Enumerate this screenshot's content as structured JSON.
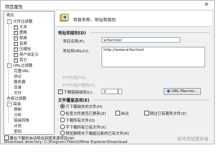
{
  "window": {
    "title": "项目属性",
    "close_glyph": "✕"
  },
  "tree": {
    "root_label": "项目",
    "items": [
      {
        "label": "文件过滤器",
        "toggle": "−",
        "level": 0
      },
      {
        "label": "文本",
        "checked": true,
        "level": 1
      },
      {
        "label": "图像",
        "checked": true,
        "level": 1
      },
      {
        "label": "视频",
        "checked": true,
        "level": 1
      },
      {
        "label": "音频",
        "checked": true,
        "level": 1
      },
      {
        "label": "压缩包",
        "checked": true,
        "level": 1
      },
      {
        "label": "用户自定义",
        "checked": true,
        "level": 1
      },
      {
        "label": "其它",
        "checked": true,
        "level": 1
      },
      {
        "label": "URL过滤器",
        "toggle": "−",
        "level": 0
      },
      {
        "label": "完整URL",
        "level": 1
      },
      {
        "label": "协议",
        "level": 1
      },
      {
        "label": "服务器",
        "level": 1
      },
      {
        "label": "目录",
        "level": 1
      },
      {
        "label": "文件",
        "level": 1
      },
      {
        "label": "内容过滤器",
        "level": 0
      },
      {
        "label": "高级",
        "toggle": "−",
        "level": 0
      },
      {
        "label": "限制",
        "level": 1
      },
      {
        "label": "分析",
        "level": 1
      },
      {
        "label": "链接转换",
        "level": 1
      },
      {
        "label": "计划",
        "level": 1
      },
      {
        "label": "密码",
        "level": 1
      }
    ]
  },
  "header": {
    "title": "项目名称、地址和级别"
  },
  "address_section": {
    "title": "地址和级别(D)",
    "project_name_label": "项目名称(P):",
    "project_name_value": "w3school",
    "url_label": "地址和URL(U):",
    "url_value": "http://www.w3school",
    "ftp_user_label": "FTP可用户(I):",
    "ftp_pass_label": "FTP可用户密码(Y):",
    "level_label": "下载链接级别(L):",
    "level_value": "3",
    "level_checked": true,
    "url_macros_button": "URL Macros..."
  },
  "override_section": {
    "title": "文件覆盖选项(E)",
    "options": [
      {
        "label": "只下载缺失的文件(H)",
        "selected": true
      },
      {
        "label": "检查文件是否已更新(Z)",
        "selected": false
      },
      {
        "label": "下载所有文件(O)",
        "selected": false
      },
      {
        "label": "不下载所有已有文件(X)",
        "selected": false
      },
      {
        "label": "预览删除并下载超过新的已有文件(R)",
        "selected": false
      }
    ],
    "checkbox_a": "自动",
    "checkbox_b": "跳过已有服务文件(Z)"
  },
  "bottom": {
    "checkbox_label": "要在下载时自动导出到现来源项目(W)",
    "download_dir": "Download directory: C:\\Program Files\\Offline Explorer\\Download"
  },
  "watermark": "软件测试爱好者"
}
